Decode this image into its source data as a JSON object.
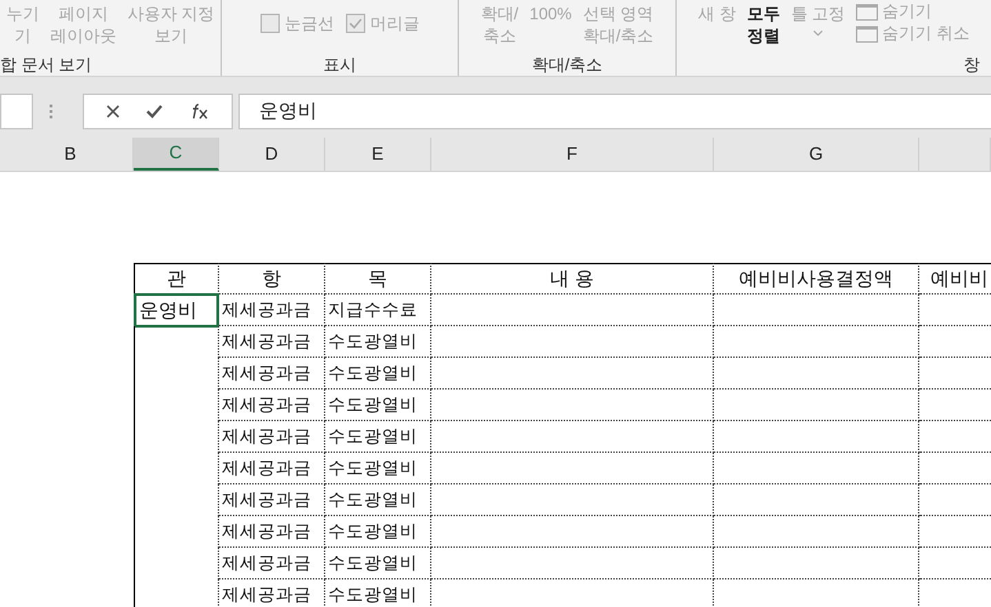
{
  "ribbon": {
    "groups": [
      {
        "label": "합 문서 보기",
        "items": [
          {
            "kind": "button",
            "lines": [
              "누기",
              "기"
            ],
            "disabled": true
          },
          {
            "kind": "button",
            "lines": [
              "페이지",
              "레이아웃"
            ],
            "disabled": true
          },
          {
            "kind": "button",
            "lines": [
              "사용자 지정",
              "보기"
            ],
            "disabled": true
          }
        ]
      },
      {
        "label": "표시",
        "items": [
          {
            "kind": "checkbox",
            "label": "눈금선",
            "checked": false,
            "disabled": true
          },
          {
            "kind": "checkbox",
            "label": "머리글",
            "checked": true,
            "disabled": true
          }
        ]
      },
      {
        "label": "확대/축소",
        "items": [
          {
            "kind": "button",
            "lines": [
              "확대/",
              "축소"
            ],
            "disabled": true
          },
          {
            "kind": "button",
            "lines": [
              "100%"
            ],
            "disabled": true
          },
          {
            "kind": "button",
            "lines": [
              "선택 영역",
              "확대/축소"
            ],
            "disabled": true
          }
        ]
      },
      {
        "label": "창",
        "items": [
          {
            "kind": "button",
            "lines": [
              "새 창"
            ],
            "disabled": true
          },
          {
            "kind": "button",
            "lines": [
              "모두",
              "정렬"
            ],
            "disabled": false
          },
          {
            "kind": "dropdown",
            "lines": [
              "틀 고정"
            ],
            "disabled": true
          },
          {
            "kind": "small",
            "label": "숨기기",
            "disabled": true
          },
          {
            "kind": "small",
            "label": "숨기기 취소",
            "disabled": true
          }
        ]
      }
    ]
  },
  "formula_bar": {
    "value": "운영비"
  },
  "column_headers": [
    {
      "label": "B",
      "selected": false
    },
    {
      "label": "C",
      "selected": true
    },
    {
      "label": "D",
      "selected": false
    },
    {
      "label": "E",
      "selected": false
    },
    {
      "label": "F",
      "selected": false
    },
    {
      "label": "G",
      "selected": false
    }
  ],
  "table": {
    "columns": [
      "관",
      "항",
      "목",
      "내 용",
      "예비비사용결정액",
      "예비비"
    ],
    "rows": [
      {
        "gwan": "운영비",
        "selected": true,
        "hang": "제세공과금",
        "mok": "지급수수료"
      },
      {
        "selected": false,
        "hang": "제세공과금",
        "mok": "수도광열비"
      },
      {
        "selected": false,
        "hang": "제세공과금",
        "mok": "수도광열비"
      },
      {
        "selected": false,
        "hang": "제세공과금",
        "mok": "수도광열비"
      },
      {
        "selected": false,
        "hang": "제세공과금",
        "mok": "수도광열비"
      },
      {
        "selected": false,
        "hang": "제세공과금",
        "mok": "수도광열비"
      },
      {
        "selected": false,
        "hang": "제세공과금",
        "mok": "수도광열비"
      },
      {
        "selected": false,
        "hang": "제세공과금",
        "mok": "수도광열비"
      },
      {
        "selected": false,
        "hang": "제세공과금",
        "mok": "수도광열비"
      },
      {
        "selected": false,
        "hang": "제세공과금",
        "mok": "수도광열비"
      }
    ]
  }
}
